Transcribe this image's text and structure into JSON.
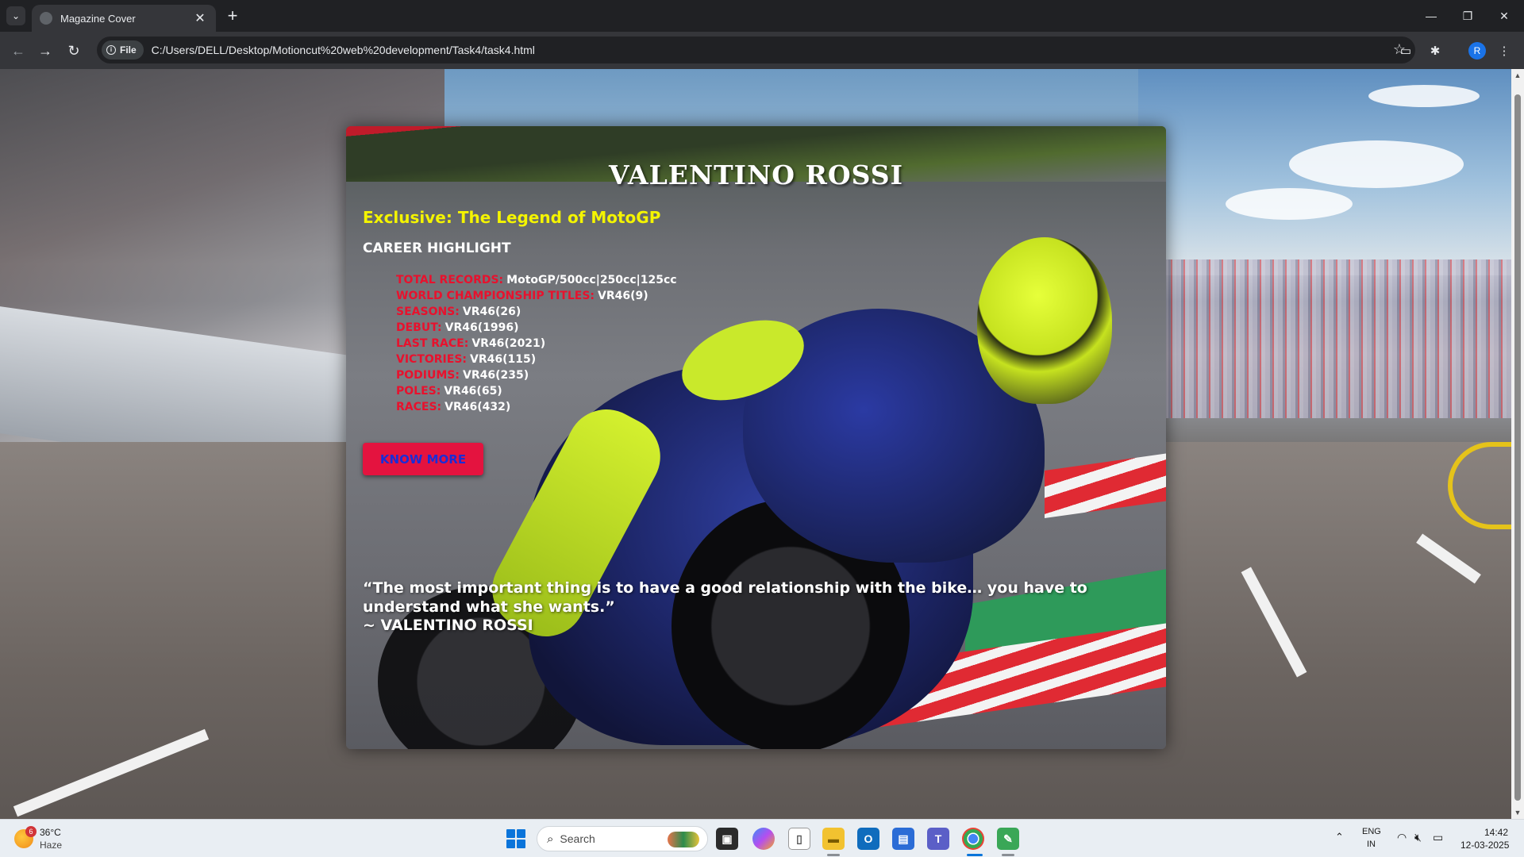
{
  "browser": {
    "tab_title": "Magazine Cover",
    "new_tab_glyph": "+",
    "close_tab_glyph": "✕",
    "chip_label": "File",
    "url": "C:/Users/DELL/Desktop/Motioncut%20web%20development/Task4/task4.html",
    "profile_initial": "R",
    "icons": [
      "tab-search-icon",
      "back-icon",
      "forward-icon",
      "reload-icon",
      "info-icon",
      "star-icon",
      "cast-icon",
      "extensions-icon",
      "menu-icon",
      "minimize-icon",
      "restore-icon",
      "close-icon"
    ]
  },
  "page": {
    "title": "VALENTINO ROSSI",
    "subtitle": "Exclusive: The Legend of MotoGP",
    "section_title": "CAREER HIGHLIGHT",
    "stats": [
      {
        "label": "TOTAL RECORDS:",
        "value": "MotoGP/500cc|250cc|125cc"
      },
      {
        "label": "WORLD CHAMPIONSHIP TITLES:",
        "value": "VR46(9)"
      },
      {
        "label": "SEASONS:",
        "value": "VR46(26)"
      },
      {
        "label": "DEBUT:",
        "value": "VR46(1996)"
      },
      {
        "label": "LAST RACE:",
        "value": "VR46(2021)"
      },
      {
        "label": "VICTORIES:",
        "value": "VR46(115)"
      },
      {
        "label": "PODIUMS:",
        "value": "VR46(235)"
      },
      {
        "label": "POLES:",
        "value": "VR46(65)"
      },
      {
        "label": "RACES:",
        "value": "VR46(432)"
      }
    ],
    "button_label": "KNOW MORE",
    "quote": "“The most important thing is to have a good relationship with the bike… you have to understand what she wants.”",
    "quote_author": "~ VALENTINO ROSSI",
    "colors": {
      "title": "#ffffff",
      "subtitle": "#f4f400",
      "stat_label": "#e8112d",
      "button_bg": "#e4133f",
      "button_text": "#1b2dd6"
    }
  },
  "taskbar": {
    "weather_badge": "6",
    "weather_temp": "36°C",
    "weather_desc": "Haze",
    "search_placeholder": "Search",
    "apps": [
      "start-icon",
      "task-view-icon",
      "copilot-icon",
      "files-icon",
      "file-explorer-icon",
      "outlook-icon",
      "store-icon",
      "teams-icon",
      "chrome-icon",
      "notepad-icon"
    ],
    "lang_line1": "ENG",
    "lang_line2": "IN",
    "time": "14:42",
    "date": "12-03-2025"
  }
}
